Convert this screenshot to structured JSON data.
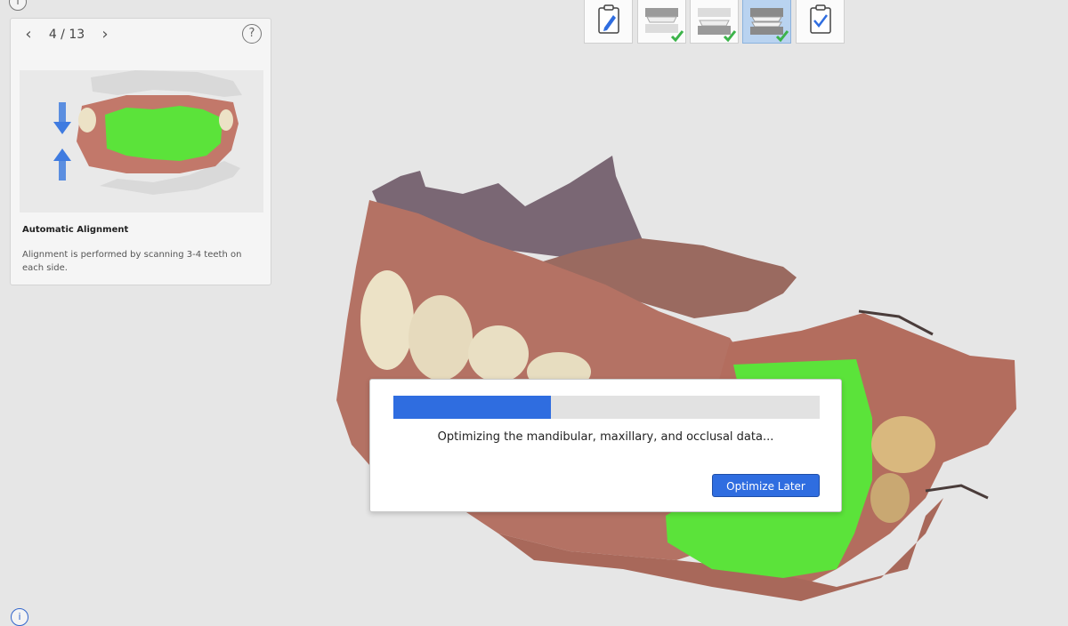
{
  "guide": {
    "page_indicator": "4 / 13",
    "prev_icon": "chevron-left-icon",
    "next_icon": "chevron-right-icon",
    "help_symbol": "?",
    "title": "Automatic Alignment",
    "description": "Alignment is performed by scanning 3-4 teeth on each side."
  },
  "toolbar": {
    "steps": [
      {
        "icon": "clipboard-pencil-icon",
        "state": "normal"
      },
      {
        "icon": "upper-jaw-check-icon",
        "state": "done"
      },
      {
        "icon": "lower-jaw-check-icon",
        "state": "done"
      },
      {
        "icon": "bite-check-icon",
        "state": "active"
      },
      {
        "icon": "clipboard-check-icon",
        "state": "normal"
      }
    ]
  },
  "dialog": {
    "progress": 0.37,
    "message": "Optimizing the mandibular, maxillary, and occlusal data...",
    "button_label": "Optimize Later"
  },
  "colors": {
    "accent": "#2f6de0",
    "success": "#3cb34a",
    "scan_highlight": "#5be33a",
    "gum": "#b76a5a",
    "tooth": "#ece2c6",
    "background": "#e6e6e6"
  }
}
